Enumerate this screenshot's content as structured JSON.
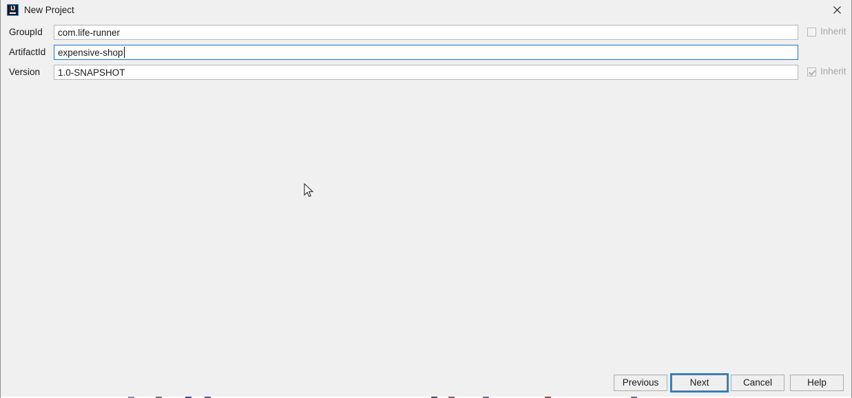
{
  "window": {
    "title": "New Project",
    "icon": "intellij-idea-icon",
    "icon_text": "IJ",
    "close_label": "✕",
    "accent_color": "#1a7fd4",
    "background_color": "#f0f0f0"
  },
  "form": {
    "fields": [
      {
        "label": "GroupId",
        "value": "com.life-runner",
        "placeholder": "",
        "focused": false,
        "name": "groupid"
      },
      {
        "label": "ArtifactId",
        "value": "expensive-shop",
        "placeholder": "",
        "focused": true,
        "name": "artifactid"
      },
      {
        "label": "Version",
        "value": "1.0-SNAPSHOT",
        "placeholder": "",
        "focused": false,
        "name": "version"
      }
    ],
    "inherit": [
      {
        "label": "Inherit",
        "checked": false,
        "enabled": false
      },
      {
        "label": "Inherit",
        "checked": true,
        "enabled": false
      }
    ]
  },
  "buttons": {
    "previous": "Previous",
    "next": "Next",
    "cancel": "Cancel",
    "help": "Help",
    "default_button": "Next"
  }
}
